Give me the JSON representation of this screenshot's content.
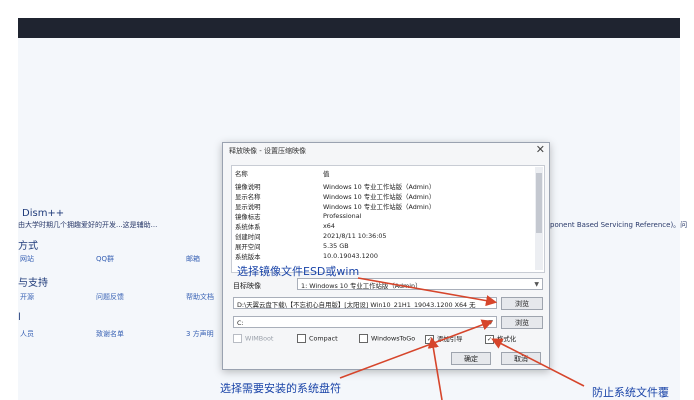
{
  "background": {
    "product_heading": "Dism++",
    "intro_text": "由大学时期几个拥趣爱好的开发...这是辅助...",
    "contact_heading": "方式",
    "links_row1": [
      "网站",
      "QQ群",
      "邮箱"
    ],
    "support_heading": "与支持",
    "links_row2": [
      "开源",
      "问题反馈",
      "帮助文档"
    ],
    "links_row3": [
      "人员",
      "致谢名单",
      "3 方声明"
    ],
    "right_text": "ponent Based Servicing Reference)。问"
  },
  "dialog": {
    "title": "释放映像 - 设置压缩映像",
    "close_glyph": "✕",
    "info_rows": [
      {
        "key": "名称",
        "value": "值"
      },
      {
        "key": "镜像说明",
        "value": "Windows 10 专业工作站版（Admin）"
      },
      {
        "key": "显示名称",
        "value": "Windows 10 专业工作站版（Admin）"
      },
      {
        "key": "显示说明",
        "value": "Windows 10 专业工作站版（Admin）"
      },
      {
        "key": "镜像标志",
        "value": "Professional"
      },
      {
        "key": "系统体系",
        "value": "x64"
      },
      {
        "key": "创建时间",
        "value": "2021/8/11 10:36:05"
      },
      {
        "key": "展开空间",
        "value": "5.35 GB"
      },
      {
        "key": "系统版本",
        "value": "10.0.19043.1200"
      }
    ],
    "target_label": "目标映像",
    "target_value": "1: Windows 10 专业工作站版（Admin）",
    "source_path": "D:\\天翼云盘下载\\【不忘初心自用版】[太阳设] Win10_21H1_19043.1200 X64 无",
    "browse_label": "浏览",
    "drive_value": "C:",
    "browse2_label": "浏览",
    "options": [
      {
        "label": "WIMBoot",
        "checked": false,
        "disabled": true
      },
      {
        "label": "Compact",
        "checked": false,
        "disabled": false
      },
      {
        "label": "WindowsToGo",
        "checked": false,
        "disabled": false
      },
      {
        "label": "添加引导",
        "checked": true,
        "disabled": false
      },
      {
        "label": "格式化",
        "checked": true,
        "disabled": false
      }
    ],
    "ok_label": "确定",
    "cancel_label": "取消"
  },
  "annotations": {
    "select_image": "选择镜像文件ESD或wim",
    "select_drive": "选择需要安装的系统盘符",
    "prevent_file": "防止系统文件覆"
  },
  "colors": {
    "arrow": "#d6452b",
    "annotation_text": "#1a44a8"
  }
}
